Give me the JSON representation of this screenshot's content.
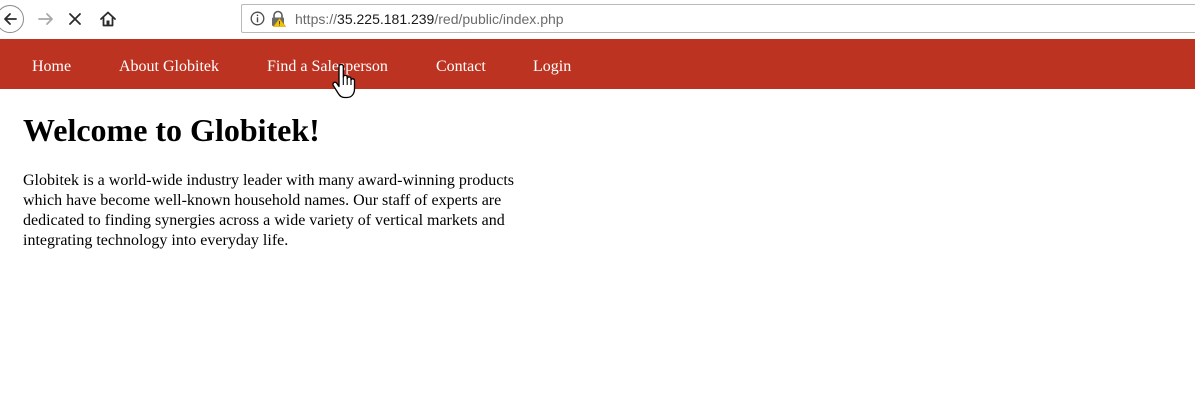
{
  "browser": {
    "url": {
      "scheme": "https://",
      "host": "35.225.181.239",
      "path": "/red/public/index.php"
    },
    "icons": [
      "back-arrow-icon",
      "forward-arrow-icon",
      "stop-icon",
      "home-icon",
      "info-icon",
      "lock-warning-icon"
    ]
  },
  "nav": {
    "items": [
      {
        "label": "Home"
      },
      {
        "label": "About Globitek"
      },
      {
        "label": "Find a Salesperson"
      },
      {
        "label": "Contact"
      },
      {
        "label": "Login"
      }
    ]
  },
  "main": {
    "heading": "Welcome to Globitek!",
    "intro": "Globitek is a world-wide industry leader with many award-winning products which have become well-known household names. Our staff of experts are dedicated to finding synergies across a wide variety of vertical markets and integrating technology into everyday life."
  },
  "colors": {
    "nav_background": "#bc3322",
    "nav_text": "#ffffff",
    "page_background": "#ffffff"
  }
}
